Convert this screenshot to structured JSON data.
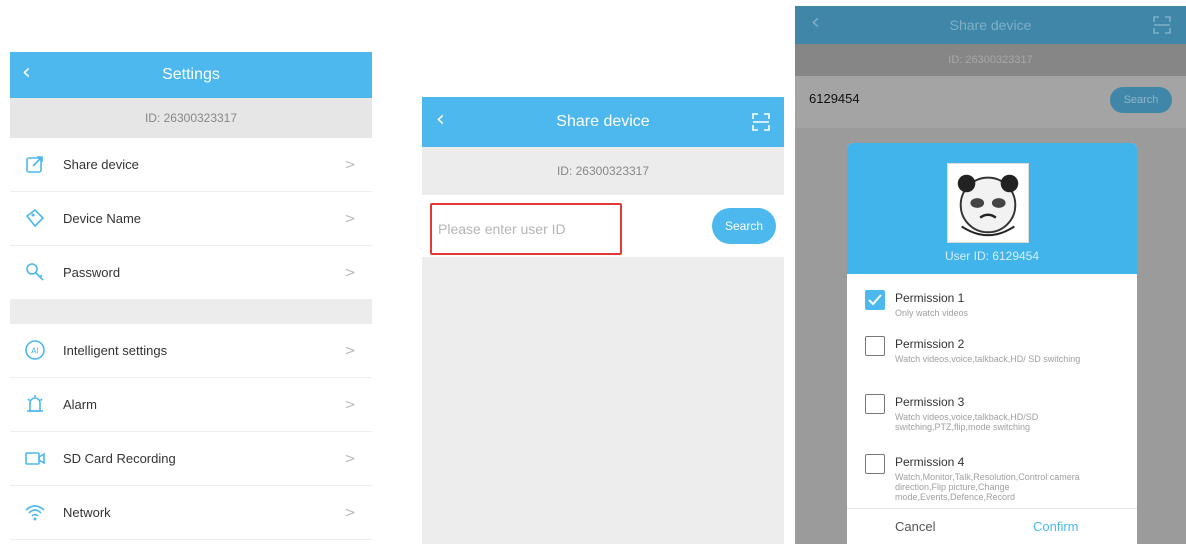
{
  "settings": {
    "title": "Settings",
    "back_icon": "chevron-left-icon",
    "device_id": "ID: 26300323317",
    "items_group1": [
      {
        "label": "Share device",
        "icon": "share-icon"
      },
      {
        "label": "Device Name",
        "icon": "tag-icon"
      },
      {
        "label": "Password",
        "icon": "key-icon"
      }
    ],
    "items_group2": [
      {
        "label": "Intelligent settings",
        "icon": "ai-icon"
      },
      {
        "label": "Alarm",
        "icon": "alarm-icon"
      },
      {
        "label": "SD Card Recording",
        "icon": "video-camera-icon"
      },
      {
        "label": "Network",
        "icon": "wifi-icon"
      }
    ],
    "chevron": ">"
  },
  "share": {
    "title": "Share device",
    "device_id": "ID: 26300323317",
    "input_placeholder": "Please enter user ID",
    "search_label": "Search",
    "scan_icon": "scan-icon"
  },
  "share_dialog_screen": {
    "title": "Share device",
    "device_id": "ID: 26300323317",
    "typed_user_id": "6129454",
    "search_label": "Search",
    "dialog": {
      "user_id": "User ID: 6129454",
      "permissions": [
        {
          "title": "Permission 1",
          "desc": "Only watch videos",
          "checked": true
        },
        {
          "title": "Permission 2",
          "desc": "Watch videos,voice,talkback,HD/ SD switching",
          "checked": false
        },
        {
          "title": "Permission 3",
          "desc": "Watch videos,voice,talkback,HD/SD switching,PTZ,flip,mode switching",
          "checked": false
        },
        {
          "title": "Permission 4",
          "desc": "Watch,Monitor,Talk,Resolution,Control camera direction,Flip picture,Change mode,Events,Defence,Record",
          "checked": false
        }
      ],
      "cancel_label": "Cancel",
      "confirm_label": "Confirm"
    }
  },
  "colors": {
    "header_blue": "#4cb8ee",
    "highlight_red": "#e53935"
  }
}
